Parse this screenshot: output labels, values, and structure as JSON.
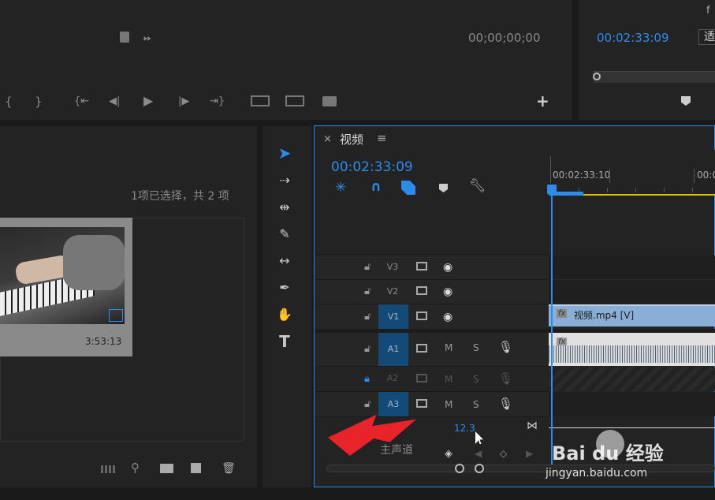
{
  "program_monitor": {
    "timecode_right": "00;00;00;00",
    "marks_left": "{",
    "marks_right": "}",
    "add_button": "+"
  },
  "source_monitor": {
    "timecode": "00:02:33:09",
    "fit_label": "适",
    "corner_text": "f"
  },
  "project_panel": {
    "selection_info": "1项已选择，共 2 项",
    "clip_duration": "3:53:13"
  },
  "timeline": {
    "close": "×",
    "title": "视频",
    "menu": "≡",
    "timecode": "00:02:33:09",
    "ruler_label_1": "00:02:33:10",
    "ruler_label_2": "00:0",
    "tracks": [
      {
        "name": "V3",
        "targeted": false
      },
      {
        "name": "V2",
        "targeted": false
      },
      {
        "name": "V1",
        "targeted": true
      },
      {
        "name": "A1",
        "targeted": true
      },
      {
        "name": "A2",
        "targeted": false
      },
      {
        "name": "A3",
        "targeted": true
      }
    ],
    "m_label": "M",
    "s_label": "S",
    "video_clip_name": "视频.mp4 [V]",
    "fx_label": "fx",
    "master_volume": "12.3",
    "master_label": "主声道"
  },
  "watermark": {
    "brand": "Bai du 经验",
    "url": "jingyan.baidu.com"
  },
  "colors": {
    "accent_blue": "#2d8ceb",
    "track_target": "#144a78",
    "clip_video": "#8aaed6",
    "arrow_red": "#e8232a"
  }
}
